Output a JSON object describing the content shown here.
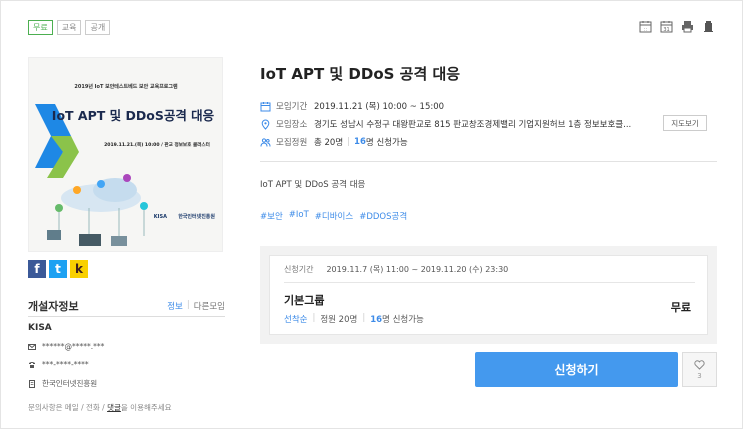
{
  "tags": [
    "무료",
    "교육",
    "공개"
  ],
  "toolbar_icons": [
    "calendar-add-icon",
    "calendar-icon",
    "print-icon",
    "bookmark-icon"
  ],
  "poster": {
    "top_text": "2019년 IoT 보안테스트베드 보안 교육프로그램",
    "headline": "IoT APT 및 DDoS공격 대응",
    "date_line": "2019.11.21.(목) 10:00 / 판교 정보보호 클러스터",
    "logo_text": "한국인터넷진흥원",
    "logo_prefix": "KISA"
  },
  "share": {
    "facebook": "f",
    "twitter": "t",
    "kakao": "k"
  },
  "host": {
    "section_title": "개설자정보",
    "tab_info": "정보",
    "tab_other": "다른모임",
    "name": "KISA",
    "email": "******@*****.***",
    "phone": "***-****-****",
    "organization": "한국인터넷진흥원",
    "note_before": "문의사항은 메일 / 전화 / ",
    "note_link": "댓글",
    "note_after": "을 이용해주세요"
  },
  "event": {
    "title": "IoT APT 및 DDoS 공격 대응",
    "date_label": "모임기간",
    "date_value": "2019.11.21 (목) 10:00 ~ 15:00",
    "place_label": "모임장소",
    "place_value": "경기도 성남시 수정구 대왕판교로 815 판교창조경제밸리 기업지원허브 1층 정보보호클...",
    "map_button": "지도보기",
    "capacity_label": "모집정원",
    "capacity_total": "총 20명",
    "capacity_sep": "|",
    "capacity_available_num": "16",
    "capacity_available_text": "명 신청가능",
    "description": "IoT APT 및 DDoS 공격 대응",
    "hashtags": [
      "#보안",
      "#IoT",
      "#디바이스",
      "#DDOS공격"
    ]
  },
  "registration": {
    "period_label": "신청기간",
    "period_value": "2019.11.7 (목) 11:00 ~ 2019.11.20 (수) 23:30",
    "group_name": "기본그룹",
    "order": "선착순",
    "capacity": "정원 20명",
    "available_num": "16",
    "available_text": "명 신청가능",
    "price": "무료",
    "apply_button": "신청하기",
    "like_count": "3"
  },
  "colors": {
    "accent": "#4499ee",
    "link": "#3d8be8",
    "free_tag": "#4caf50"
  }
}
